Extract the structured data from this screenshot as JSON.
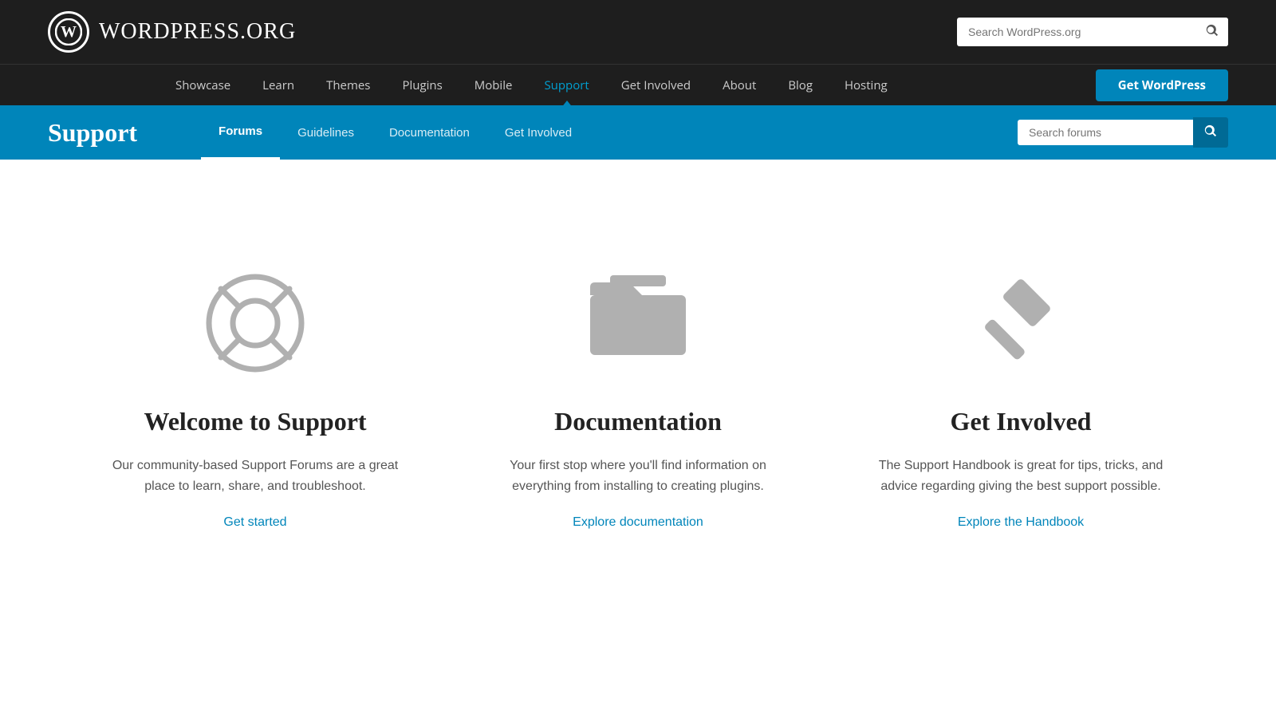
{
  "topbar": {
    "logo_letter": "W",
    "logo_name": "WordPress",
    "logo_suffix": ".org",
    "search_placeholder": "Search WordPress.org"
  },
  "mainnav": {
    "items": [
      {
        "label": "Showcase",
        "active": false
      },
      {
        "label": "Learn",
        "active": false
      },
      {
        "label": "Themes",
        "active": false
      },
      {
        "label": "Plugins",
        "active": false
      },
      {
        "label": "Mobile",
        "active": false
      },
      {
        "label": "Support",
        "active": true
      },
      {
        "label": "Get Involved",
        "active": false
      },
      {
        "label": "About",
        "active": false
      },
      {
        "label": "Blog",
        "active": false
      },
      {
        "label": "Hosting",
        "active": false
      }
    ],
    "get_wp_label": "Get WordPress"
  },
  "supportbar": {
    "title": "Support",
    "nav": [
      {
        "label": "Forums",
        "active": true
      },
      {
        "label": "Guidelines",
        "active": false
      },
      {
        "label": "Documentation",
        "active": false
      },
      {
        "label": "Get Involved",
        "active": false
      }
    ],
    "search_placeholder": "Search forums"
  },
  "cards": [
    {
      "id": "welcome",
      "heading": "Welcome to Support",
      "description": "Our community-based Support Forums are a great place to learn, share, and troubleshoot.",
      "link_label": "Get started"
    },
    {
      "id": "documentation",
      "heading": "Documentation",
      "description": "Your first stop where you'll find information on everything from installing to creating plugins.",
      "link_label": "Explore documentation"
    },
    {
      "id": "get-involved",
      "heading": "Get Involved",
      "description": "The Support Handbook is great for tips, tricks, and advice regarding giving the best support possible.",
      "link_label": "Explore the Handbook"
    }
  ],
  "colors": {
    "primary_blue": "#0085ba",
    "dark_bg": "#1e1e1e",
    "support_bar": "#0085ba"
  }
}
